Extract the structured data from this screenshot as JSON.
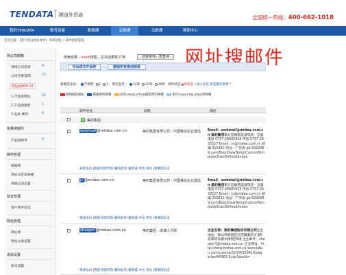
{
  "header": {
    "logo_text": "TENDATA",
    "logo_tm": "™",
    "logo_sub": "腾道外贸通",
    "hotline_label": "全国统一热线：",
    "hotline_number": "400-662-1018"
  },
  "nav": {
    "items": [
      "我的TENDATA",
      "账号设置",
      "数据通",
      "云邮通",
      "云邮通",
      "帮助中心"
    ],
    "active_index": 3
  },
  "breadcrumb": "您的位置：【客户网址搜索邮件】项目管理 > 邮件搜索管理",
  "sidebar": {
    "sections": [
      {
        "title": "我公司邮箱",
        "items": [
          {
            "label": "待搜公司名单",
            "num": "9"
          },
          {
            "label": "公司名单官网",
            "num": "12"
          },
          {
            "label": "网址搜邮件 19",
            "num": ""
          },
          {
            "label": "1.产品搜网址",
            "num": "26"
          },
          {
            "label": "2.产品搜搜索",
            "num": "1"
          },
          {
            "label": "3.名录 黄页",
            "num": "6"
          }
        ]
      },
      {
        "title": "批量搜邮件",
        "items": [
          {
            "label": "产品搜邮件",
            "num": "6"
          }
        ]
      },
      {
        "title": "邮件管理",
        "items": [
          {
            "label": "邮箱库"
          },
          {
            "label": "添加白名单邮箱"
          },
          {
            "label": "邮箱过滤设置"
          }
        ]
      },
      {
        "title": "验证管理",
        "items": [
          {
            "label": "客户邮件验证"
          }
        ]
      },
      {
        "title": "网址管理",
        "items": [
          {
            "label": "网址库"
          },
          {
            "label": "网址过滤设置"
          }
        ]
      },
      {
        "title": "系统设置",
        "items": [
          {
            "label": "账号设置"
          }
        ]
      }
    ]
  },
  "main": {
    "status_prefix": "搜索结果：",
    "status_keyword": "meidi",
    "status_mid": "搜集，总共结果数",
    "status_count": "37",
    "status_unit": "条",
    "change_button": "改变条件，再查询",
    "big_title": "网址搜邮件",
    "export_button": "导出成文件保存",
    "delete_button": "删除所有查询结果",
    "filter": {
      "label1": "重要度过滤：",
      "opt_none": "不限制",
      "opt_1": "1",
      "opt_2": "2",
      "label2": "每页显示：",
      "per_page": [
        "16条",
        "20条",
        "38条"
      ],
      "verify_label": "邮件验证",
      "unverified": "未验证",
      "verify_link": "+加入验证",
      "verify_note": "验证服务说明"
    },
    "legend": {
      "items": [
        "邮箱域名相似",
        "最重要的邮箱",
        "表示sale@,info@最常用的邮箱",
        "表示support@,job@等邮箱"
      ]
    },
    "table_headers": [
      "邮件地址",
      "标题",
      "描述"
    ],
    "group": {
      "label": "美的集团"
    },
    "rows": [
      {
        "email_hl": "webmail",
        "email_rest": "@midea.com.cn",
        "company": "美的集团有限公司 - 中国移动企业建站",
        "desc_bold1": "Email：webmail@midea.com.cn 美的集团",
        "desc": "审计监察部监督电话：监督电话 0757-26665919 传真 0757-2633527 Email：jc@midea.com.cn 邮编 315831 地址：广东省 gd.6292989.com/BossShowTemp/CustomTemplate/UserDefined/Index",
        "actions": [
          "来源访问",
          "管理",
          "修改内容",
          "删除此项",
          "翻译成",
          "中文",
          "英文",
          "重要度标记"
        ]
      },
      {
        "email_hl": "jc",
        "email_rest": "@midea.com.cn",
        "company": "美的集团有限公司 - 中国移动企业建站",
        "desc_bold1": "Email：webmail@midea.com.cn 美的集团",
        "desc": "审计监察部监督电话：监督电话 0757-26665919 传真 0757-2633527 Email：jc@midea.com.cn 邮编 315831 地址：广东省 gd.6292989.com/BossShowTemp/CustomTemplate/UserDefined/Index",
        "actions": [
          "来源访问",
          "管理",
          "修改内容",
          "删除此项",
          "翻译成",
          "中文",
          "英文",
          "重要度标记"
        ]
      },
      {
        "email_hl": "zhaopin",
        "email_rest": "@midea.com.cn",
        "company": "美的集团 - 卓博人才网",
        "desc_bold1": "企业名称：美的集团股份有限公司",
        "desc": "企业地址：佛山市顺德区北滘镇美的大道6号美的总部大楼B区6楼 企业邮件：zhaopin3@midea.com.cn 企业网址：http://www.midea.com.cn www.jobcn.com/cozone/32/04/320419/page/test40983 6.jsp?posid=",
        "actions": [
          "来源访问",
          "管理",
          "修改内容",
          "删除此项",
          "翻译成",
          "中文",
          "英文",
          "重要度标记"
        ]
      }
    ]
  },
  "colors": {
    "brand_blue": "#1c5aa8",
    "title_red": "#e2241b",
    "group_green": "#41a540"
  }
}
